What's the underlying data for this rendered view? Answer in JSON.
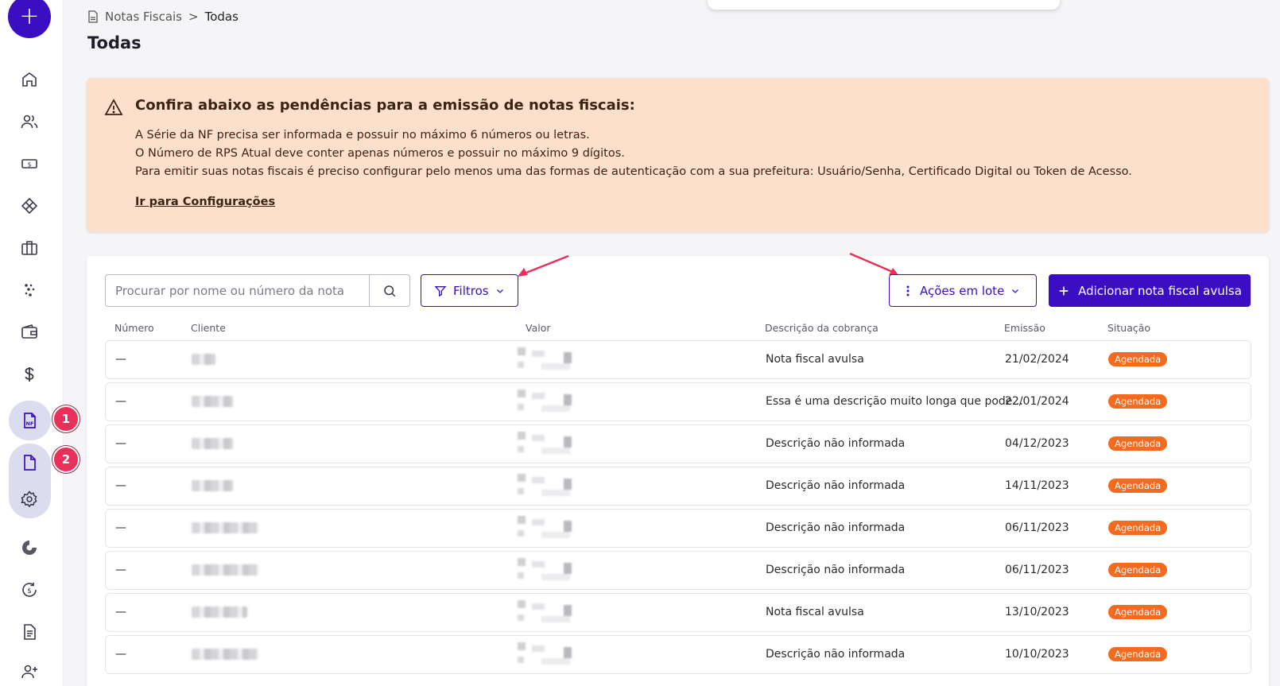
{
  "sidebar": {
    "fab_label": "+",
    "step1": "1",
    "step2": "2"
  },
  "breadcrumb": {
    "parent": "Notas Fiscais",
    "separator": ">",
    "current": "Todas"
  },
  "page": {
    "title": "Todas"
  },
  "alert": {
    "title": "Confira abaixo as pendências para a emissão de notas fiscais:",
    "lines": [
      "A Série da NF precisa ser informada e possuir no máximo 6 números ou letras.",
      "O Número de RPS Atual deve conter apenas números e possuir no máximo 9 dígitos.",
      "Para emitir suas notas fiscais é preciso configurar pelo menos uma das formas de autenticação com a sua prefeitura: Usuário/Senha, Certificado Digital ou Token de Acesso."
    ],
    "link": "Ir para Configurações"
  },
  "toolbar": {
    "search_placeholder": "Procurar por nome ou número da nota",
    "filters_label": "Filtros",
    "bulk_label": "Ações em lote",
    "add_label": "Adicionar nota fiscal avulsa"
  },
  "table": {
    "headers": [
      "Número",
      "Cliente",
      "Valor",
      "Descrição da cobrança",
      "Emissão",
      "Situação"
    ],
    "rows": [
      {
        "numero": "—",
        "descricao": "Nota fiscal avulsa",
        "emissao": "21/02/2024",
        "situacao": "Agendada"
      },
      {
        "numero": "—",
        "descricao": "Essa é uma descrição muito longa que pode...",
        "emissao": "22/01/2024",
        "situacao": "Agendada"
      },
      {
        "numero": "—",
        "descricao": "Descrição não informada",
        "emissao": "04/12/2023",
        "situacao": "Agendada"
      },
      {
        "numero": "—",
        "descricao": "Descrição não informada",
        "emissao": "14/11/2023",
        "situacao": "Agendada"
      },
      {
        "numero": "—",
        "descricao": "Descrição não informada",
        "emissao": "06/11/2023",
        "situacao": "Agendada"
      },
      {
        "numero": "—",
        "descricao": "Descrição não informada",
        "emissao": "06/11/2023",
        "situacao": "Agendada"
      },
      {
        "numero": "—",
        "descricao": "Nota fiscal avulsa",
        "emissao": "13/10/2023",
        "situacao": "Agendada"
      },
      {
        "numero": "—",
        "descricao": "Descrição não informada",
        "emissao": "10/10/2023",
        "situacao": "Agendada"
      }
    ]
  },
  "colors": {
    "primary": "#3b0ec4",
    "alert_bg": "#fde0cc",
    "status": "#f46a1f",
    "step_badge": "#e8305a"
  }
}
